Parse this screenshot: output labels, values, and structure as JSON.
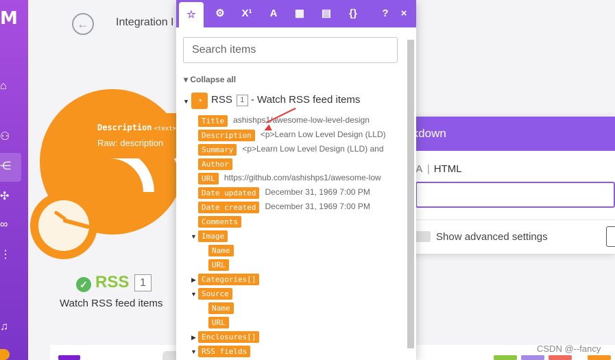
{
  "breadcrumb": {
    "text": "Integration I"
  },
  "node": {
    "title": "RSS",
    "number": "1",
    "subtitle": "Watch RSS feed items"
  },
  "tooltip": {
    "name": "Description",
    "type": "<text>",
    "raw": "Raw: description"
  },
  "markdown_panel": {
    "title": "rkdown",
    "toolbar_a": "A",
    "toolbar_html": "HTML",
    "advanced_label": "Show advanced settings"
  },
  "picker": {
    "tabs": [
      {
        "icon": "star-icon",
        "glyph": "☆"
      },
      {
        "icon": "gear-icon",
        "glyph": "⚙"
      },
      {
        "icon": "superscript-icon",
        "glyph": "X¹"
      },
      {
        "icon": "text-icon",
        "glyph": "A"
      },
      {
        "icon": "calendar-icon",
        "glyph": "▦"
      },
      {
        "icon": "table-icon",
        "glyph": "▤"
      },
      {
        "icon": "braces-icon",
        "glyph": "{}"
      },
      {
        "icon": "help-icon",
        "glyph": "?"
      },
      {
        "icon": "close-icon",
        "glyph": "×"
      }
    ],
    "search_placeholder": "Search items",
    "collapse_all": "Collapse all",
    "module_label": "RSS",
    "module_number": "1",
    "module_desc": "- Watch RSS feed items",
    "items": [
      {
        "label": "Title",
        "value": "ashishps1/awesome-low-level-design"
      },
      {
        "label": "Description",
        "value": "<p>Learn Low Level Design (LLD)"
      },
      {
        "label": "Summary",
        "value": "<p>Learn Low Level Design (LLD) and"
      },
      {
        "label": "Author",
        "value": ""
      },
      {
        "label": "URL",
        "value": "https://github.com/ashishps1/awesome-low"
      },
      {
        "label": "Date updated",
        "value": "December 31, 1969 7:00 PM"
      },
      {
        "label": "Date created",
        "value": "December 31, 1969 7:00 PM"
      },
      {
        "label": "Comments",
        "value": ""
      },
      {
        "label": "Image",
        "value": ""
      },
      {
        "label": "Name",
        "value": ""
      },
      {
        "label": "URL",
        "value": ""
      },
      {
        "label": "Categories[]",
        "value": ""
      },
      {
        "label": "Source",
        "value": ""
      },
      {
        "label": "Name",
        "value": ""
      },
      {
        "label": "URL",
        "value": ""
      },
      {
        "label": "Enclosures[]",
        "value": ""
      },
      {
        "label": "RSS fields",
        "value": ""
      }
    ]
  },
  "watermark": "CSDN @--fancy",
  "colors": {
    "purple": "#8d59e6",
    "orange": "#f7941d",
    "green": "#8dc63f",
    "arrow": "#e53935"
  }
}
